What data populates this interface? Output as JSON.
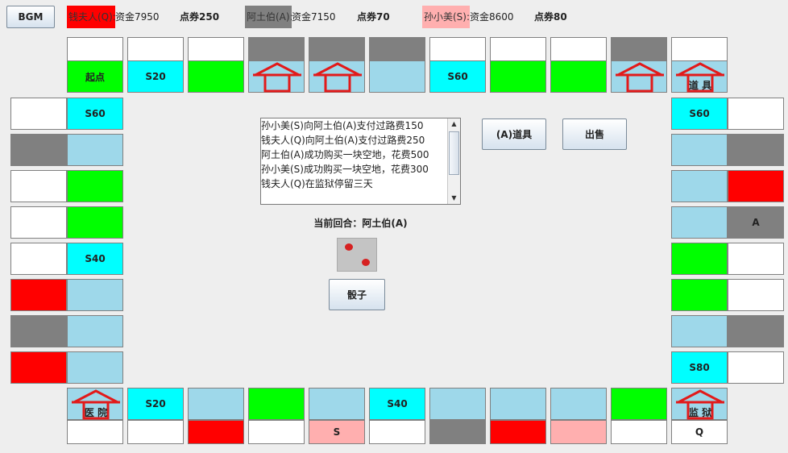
{
  "toolbar": {
    "bgm_label": "BGM"
  },
  "players": [
    {
      "color": "#ff0000",
      "name": "钱夫人(Q):",
      "funds": "资金7950",
      "points": "点券250"
    },
    {
      "color": "#808080",
      "name": "阿土伯(A):",
      "funds": "资金7150",
      "points": "点券70"
    },
    {
      "color": "#ffafaf",
      "name": "孙小美(S):",
      "funds": "资金8600",
      "points": "点券80"
    }
  ],
  "colors": {
    "blank": "#ffffff",
    "land": "#9ed8ea",
    "cyan": "#00ffff",
    "green": "#00ff00",
    "red": "#ff0000",
    "gray": "#808080",
    "pink": "#ffafaf",
    "house_red": "#e21a1a"
  },
  "board": {
    "top": [
      {
        "owner": "blank",
        "land": "green",
        "label": "起点"
      },
      {
        "owner": "blank",
        "land": "cyan",
        "label": "S20"
      },
      {
        "owner": "blank",
        "land": "green",
        "label": ""
      },
      {
        "owner": "gray",
        "land": "land",
        "icon": "house-icon"
      },
      {
        "owner": "gray",
        "land": "land",
        "icon": "house-icon"
      },
      {
        "owner": "gray",
        "land": "land",
        "label": ""
      },
      {
        "owner": "blank",
        "land": "cyan",
        "label": "S60"
      },
      {
        "owner": "blank",
        "land": "green",
        "label": ""
      },
      {
        "owner": "blank",
        "land": "green",
        "label": ""
      },
      {
        "owner": "gray",
        "land": "land",
        "icon": "house-icon"
      },
      {
        "owner": "blank",
        "land": "land",
        "icon": "house-icon",
        "label": "道 具"
      }
    ],
    "left": [
      {
        "owner": "blank",
        "land": "cyan",
        "label": "S60"
      },
      {
        "owner": "gray",
        "land": "land",
        "label": ""
      },
      {
        "owner": "blank",
        "land": "green",
        "label": ""
      },
      {
        "owner": "blank",
        "land": "green",
        "label": ""
      },
      {
        "owner": "blank",
        "land": "cyan",
        "label": "S40"
      },
      {
        "owner": "red",
        "land": "land",
        "label": ""
      },
      {
        "owner": "gray",
        "land": "land",
        "label": ""
      },
      {
        "owner": "red",
        "land": "land",
        "label": ""
      }
    ],
    "right": [
      {
        "owner": "blank",
        "land": "cyan",
        "label": "S60"
      },
      {
        "owner": "gray",
        "land": "land",
        "label": ""
      },
      {
        "owner": "red",
        "land": "land",
        "label": ""
      },
      {
        "owner": "gray",
        "land": "land",
        "owner_label": "A"
      },
      {
        "owner": "blank",
        "land": "green",
        "label": ""
      },
      {
        "owner": "blank",
        "land": "green",
        "label": ""
      },
      {
        "owner": "gray",
        "land": "land",
        "label": ""
      },
      {
        "owner": "blank",
        "land": "cyan",
        "label": "S80"
      }
    ],
    "bottom": [
      {
        "owner": "blank",
        "land": "land",
        "icon": "house-icon",
        "label": "医 院"
      },
      {
        "owner": "blank",
        "land": "cyan",
        "label": "S20"
      },
      {
        "owner": "red",
        "land": "land",
        "label": ""
      },
      {
        "owner": "blank",
        "land": "green",
        "label": ""
      },
      {
        "owner": "pink",
        "land": "land",
        "owner_label": "S"
      },
      {
        "owner": "blank",
        "land": "cyan",
        "label": "S40"
      },
      {
        "owner": "gray",
        "land": "land",
        "label": ""
      },
      {
        "owner": "red",
        "land": "land",
        "label": ""
      },
      {
        "owner": "pink",
        "land": "land",
        "label": ""
      },
      {
        "owner": "blank",
        "land": "green",
        "label": ""
      },
      {
        "owner": "blank",
        "land": "land",
        "icon": "house-icon",
        "label": "监 狱",
        "owner_label": "Q"
      }
    ]
  },
  "actions": {
    "props_label": "(A)道具",
    "sell_label": "出售",
    "dice_label": "骰子"
  },
  "log": [
    "孙小美(S)向阿土伯(A)支付过路费150",
    "钱夫人(Q)向阿土伯(A)支付过路费250",
    "阿土伯(A)成功购买一块空地，花费500",
    "孙小美(S)成功购买一块空地，花费300",
    "钱夫人(Q)在监狱停留三天"
  ],
  "turn": "当前回合：阿土伯(A)",
  "dice": {
    "value": 2
  }
}
